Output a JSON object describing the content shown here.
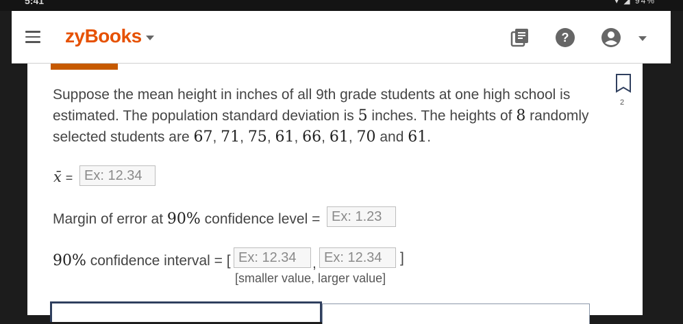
{
  "status_bar": {
    "time": "5:41",
    "system": "▾ ◢ 94%"
  },
  "app": {
    "brand": "zyBooks"
  },
  "bookmark": {
    "count": "2"
  },
  "problem": {
    "p1": "Suppose the mean height in inches of all 9th grade students at one high school is estimated. The population standard deviation is ",
    "sd": "5",
    "p2": " inches. The heights of ",
    "n": "8",
    "p3": " randomly selected students are ",
    "values": [
      "67",
      "71",
      "75",
      "61",
      "66",
      "61",
      "70"
    ],
    "and": " and ",
    "last_value": "61",
    "period": "."
  },
  "mean_row": {
    "symbol": "x̄",
    "equals": "=",
    "placeholder": "Ex: 12.34"
  },
  "moe_row": {
    "pre": "Margin of error at ",
    "pct": "90%",
    "post": " confidence level =",
    "placeholder": "Ex: 1.23"
  },
  "ci_row": {
    "pct": "90%",
    "post": " confidence interval = [",
    "placeholder_low": "Ex: 12.34",
    "comma": ",",
    "placeholder_high": "Ex: 12.34",
    "close": "]",
    "hint": "[smaller value, larger value]"
  }
}
